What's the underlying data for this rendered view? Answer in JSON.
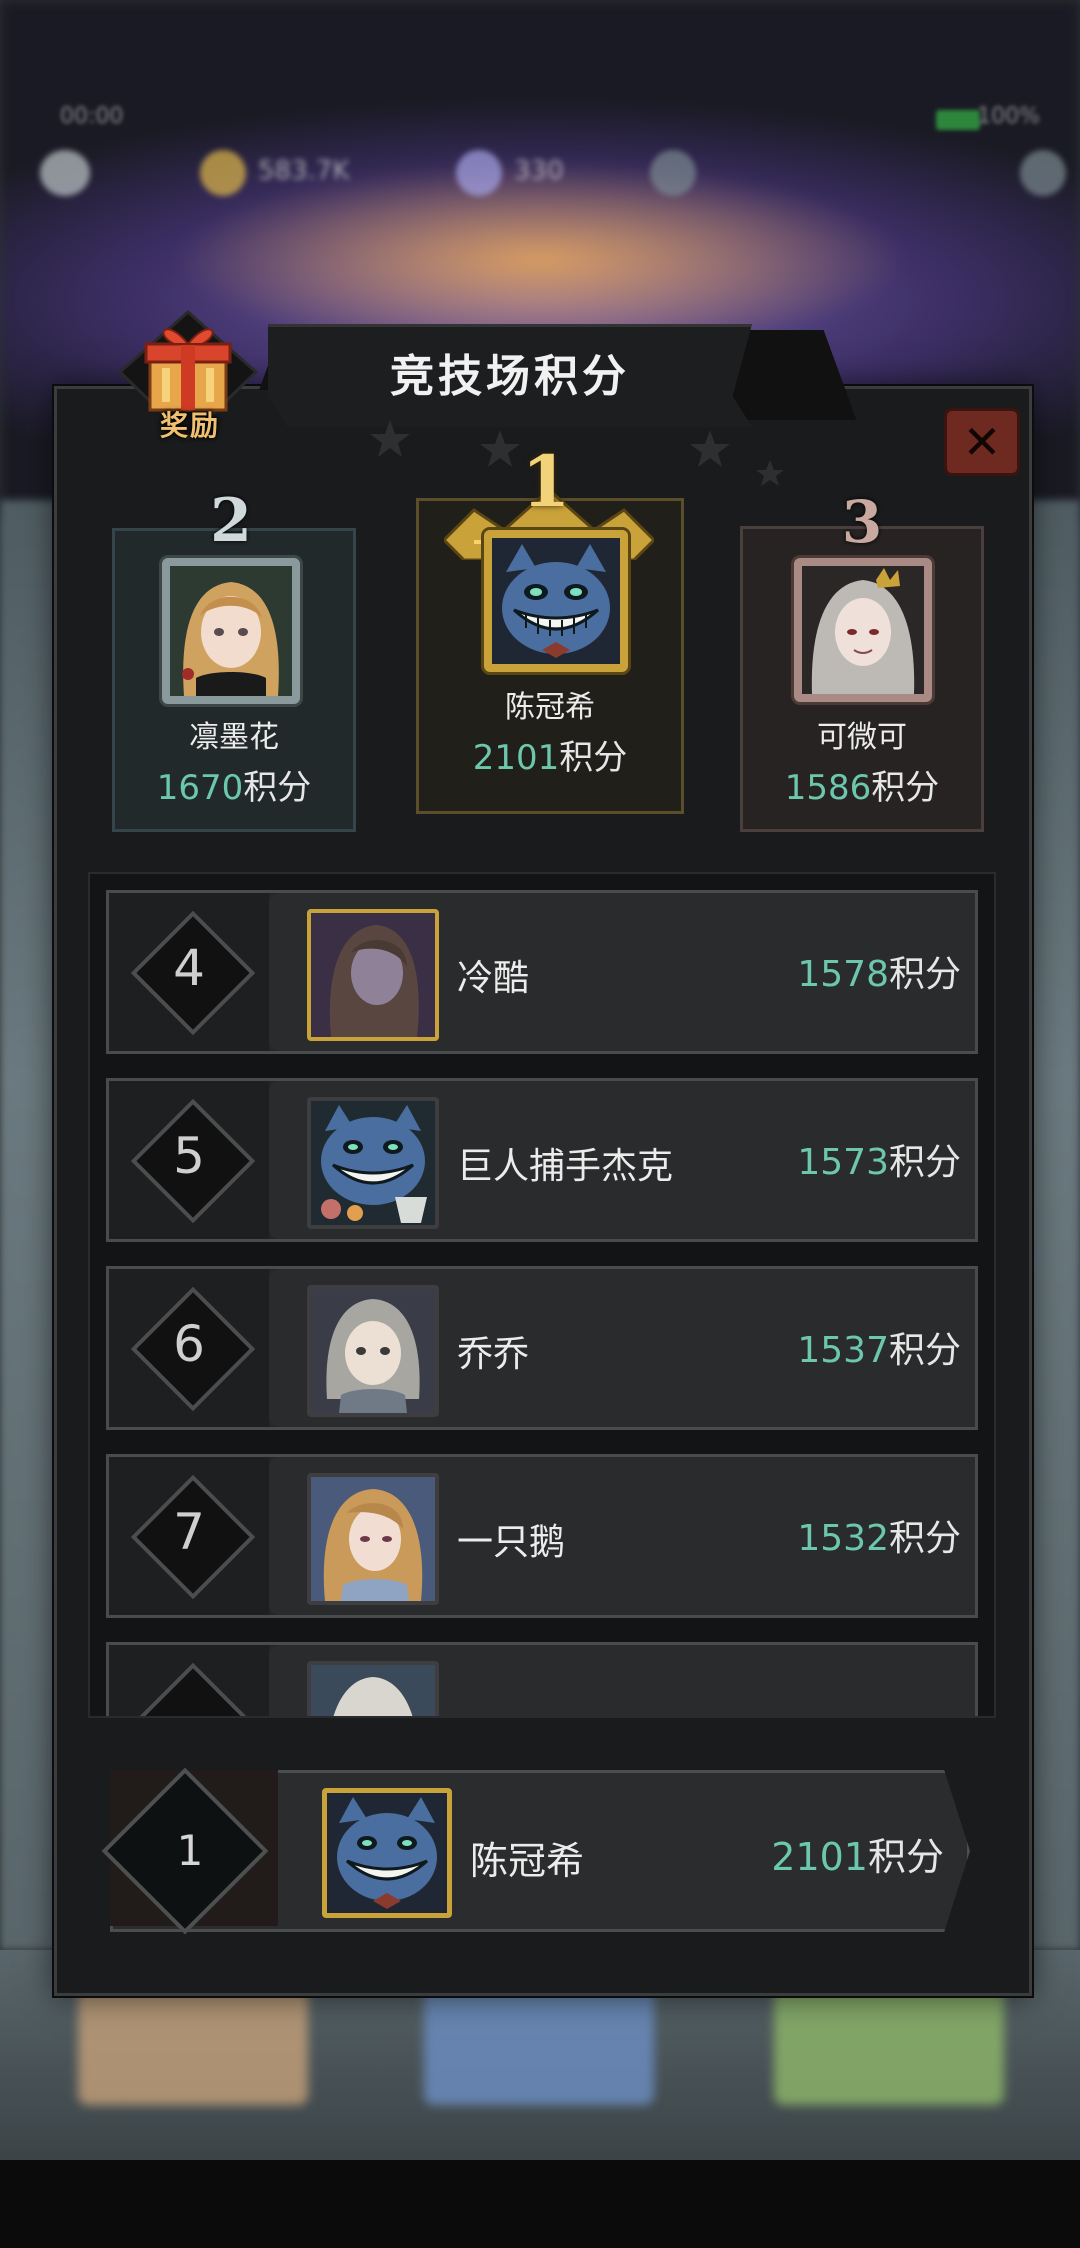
{
  "status_bar": {
    "left_text": "00:00",
    "right_text": "100%"
  },
  "top_resources": {
    "gold": "583.7K",
    "gems": "330"
  },
  "panel": {
    "title": "竞技场积分",
    "reward_label": "奖励",
    "close_symbol": "✕",
    "score_suffix": "积分"
  },
  "podium": [
    {
      "rank": "2",
      "name": "凛墨花",
      "score": "1670",
      "avatar_icon": "blonde-girl-portrait"
    },
    {
      "rank": "1",
      "name": "陈冠希",
      "score": "2101",
      "avatar_icon": "blue-cat-portrait"
    },
    {
      "rank": "3",
      "name": "可微可",
      "score": "1586",
      "avatar_icon": "silver-hair-queen-portrait"
    }
  ],
  "list": [
    {
      "rank": "4",
      "name": "冷酷",
      "score": "1578",
      "avatar_icon": "dark-hair-portrait"
    },
    {
      "rank": "5",
      "name": "巨人捕手杰克",
      "score": "1573",
      "avatar_icon": "blue-cat-portrait"
    },
    {
      "rank": "6",
      "name": "乔乔",
      "score": "1537",
      "avatar_icon": "grey-hair-girl-portrait"
    },
    {
      "rank": "7",
      "name": "一只鹅",
      "score": "1532",
      "avatar_icon": "blonde-lady-portrait"
    }
  ],
  "my_rank": {
    "rank": "1",
    "name": "陈冠希",
    "score": "2101",
    "avatar_icon": "blue-cat-portrait"
  },
  "colors": {
    "score_accent": "#6cc7ad",
    "gold_frame": "#c9a23a",
    "close_red": "#6e2a20"
  }
}
